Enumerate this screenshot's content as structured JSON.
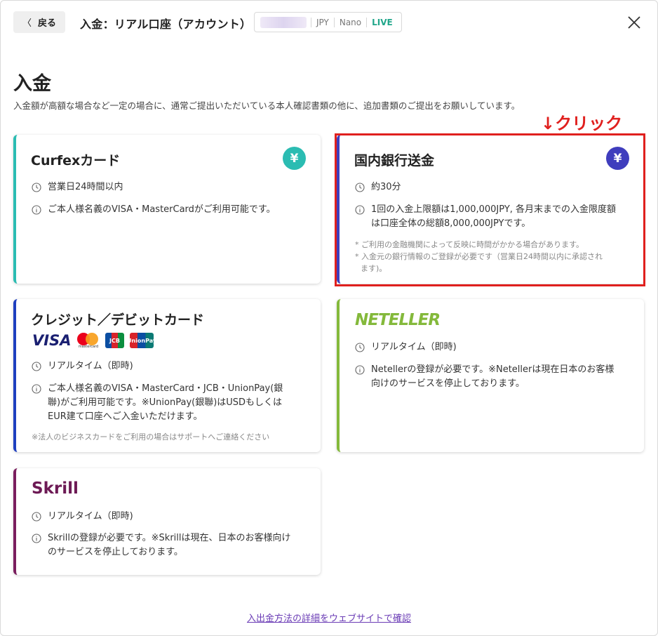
{
  "header": {
    "back_label": "戻る",
    "title": "入金：リアル口座（アカウント）",
    "account": {
      "currency": "JPY",
      "type": "Nano",
      "mode": "LIVE"
    }
  },
  "page": {
    "title": "入金",
    "description": "入金額が高額な場合など一定の場合に、通常ご提出いただいている本人確認書類の他に、追加書類のご提出をお願いしています。"
  },
  "annotation": "↓クリック",
  "cards": {
    "curfex": {
      "title": "Curfexカード",
      "yen": "¥",
      "time": "営業日24時間以内",
      "info": "ご本人様名義のVISA・MasterCardがご利用可能です。"
    },
    "bank": {
      "title": "国内銀行送金",
      "yen": "¥",
      "time": "約30分",
      "info_line1": "1回の入金上限額は1,000,000JPY, 各月末までの入金限度額",
      "info_line2": "は口座全体の総額8,000,000JPYです。",
      "note1": "* ご利用の金融機関によって反映に時間がかかる場合があります。",
      "note2a": "* 入金元の銀行情報のご登録が必要です（営業日24時間以内に承認され",
      "note2b": "ます)。"
    },
    "credit": {
      "title": "クレジット／デビットカード",
      "logos": {
        "visa": "VISA",
        "mastercard": "mastercard",
        "jcb": "JCB",
        "unionpay": "UnionPay"
      },
      "time": "リアルタイム（即時)",
      "info_line1": "ご本人様名義のVISA・MasterCard・JCB・UnionPay(銀",
      "info_line2": "聯)がご利用可能です。※UnionPay(銀聯)はUSDもしくは",
      "info_line3": "EUR建て口座へご入金いただけます。",
      "note": "※法人のビジネスカードをご利用の場合はサポートへご連絡ください"
    },
    "neteller": {
      "logo": "NETELLER",
      "time": "リアルタイム（即時)",
      "info_line1": "Netellerの登録が必要です。※Netellerは現在日本のお客様",
      "info_line2": "向けのサービスを停止しております。"
    },
    "skrill": {
      "logo": "Skrill",
      "time": "リアルタイム（即時)",
      "info_line1": "Skrillの登録が必要です。※Skrillは現在、日本のお客様向け",
      "info_line2": "のサービスを停止しております。"
    }
  },
  "footer": {
    "link": "入出金方法の詳細をウェブサイトで確認"
  },
  "colors": {
    "curfex": "#2bbcb2",
    "bank": "#3f3dbd",
    "credit": "#1e3fbf",
    "neteller": "#84b93b",
    "skrill": "#7a1e5e",
    "highlight": "#e0201e"
  }
}
